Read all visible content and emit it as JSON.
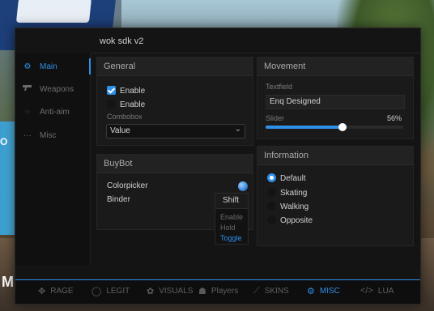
{
  "window": {
    "title": "wok sdk v2"
  },
  "sidebar": {
    "items": [
      {
        "label": "Main",
        "icon": "gears-icon",
        "active": true
      },
      {
        "label": "Weapons",
        "icon": "gun-icon",
        "active": false
      },
      {
        "label": "Anti-aim",
        "icon": "crosshair-icon",
        "active": false
      },
      {
        "label": "Misc",
        "icon": "dots-icon",
        "active": false
      }
    ]
  },
  "general": {
    "title": "General",
    "enable1": {
      "label": "Enable",
      "checked": true
    },
    "enable2": {
      "label": "Enable",
      "checked": false
    },
    "combobox": {
      "label": "Combobox",
      "value": "Value"
    }
  },
  "buybot": {
    "title": "BuyBot",
    "colorpicker_label": "Colorpicker",
    "colorpicker_color": "#3a86d6",
    "binder_label": "Binder",
    "binder": {
      "key": "Shift",
      "modes": [
        "Enable",
        "Hold",
        "Toggle"
      ],
      "selected_mode": "Toggle"
    }
  },
  "movement": {
    "title": "Movement",
    "textfield": {
      "label": "Textfield",
      "value": "Enq Designed"
    },
    "slider": {
      "label": "Slider",
      "value": 56,
      "value_text": "56%"
    }
  },
  "information": {
    "title": "Information",
    "options": [
      "Default",
      "Skating",
      "Walking",
      "Opposite"
    ],
    "selected": "Default"
  },
  "bottom_tabs": [
    {
      "label": "RAGE",
      "icon": "crosshair-icon",
      "active": false
    },
    {
      "label": "LEGIT",
      "icon": "circle-icon",
      "active": false
    },
    {
      "label": "VISUALS",
      "icon": "palette-icon",
      "active": false
    },
    {
      "label": "Players",
      "icon": "players-icon",
      "active": false
    },
    {
      "label": "SKINS",
      "icon": "knife-icon",
      "active": false
    },
    {
      "label": "MISC",
      "icon": "gears-icon",
      "active": true
    },
    {
      "label": "LUA",
      "icon": "code-icon",
      "active": false
    }
  ],
  "background_text": {
    "left_letters": "M I",
    "left_mid": "O"
  },
  "colors": {
    "accent": "#2f90e8",
    "window_bg": "#141414",
    "panel_bg": "#1a1a1a"
  }
}
